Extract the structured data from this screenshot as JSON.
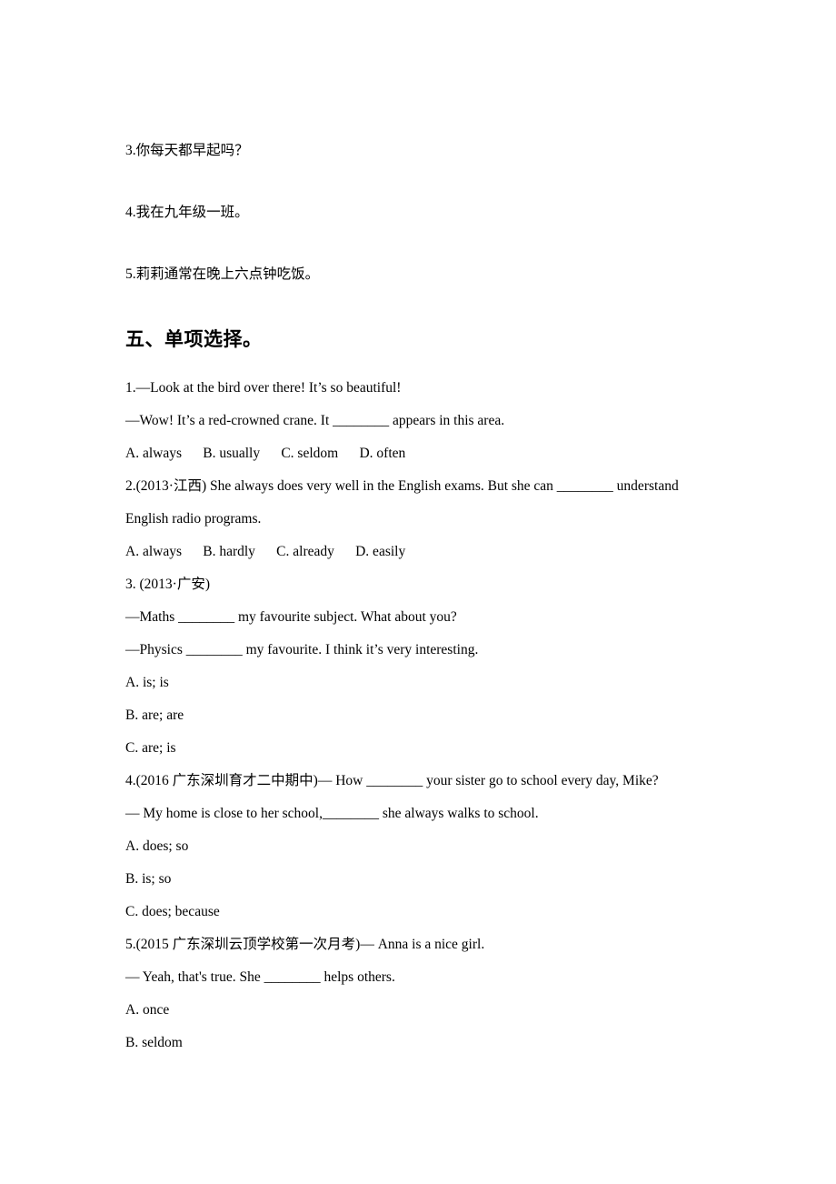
{
  "document": {
    "translation_section": {
      "items": [
        {
          "number": "3.",
          "text": "你每天都早起吗？"
        },
        {
          "number": "4.",
          "text": "我在九年级一班。"
        },
        {
          "number": "5.",
          "text": "莉莉通常在晚上六点钟吃饭。"
        }
      ]
    },
    "choice_section": {
      "heading": "五、单项选择。",
      "questions": [
        {
          "id": "q1",
          "lines": [
            "1.—Look at the bird over there! It’s so beautiful!",
            "—Wow! It’s a red-crowned crane. It ________ appears in this area."
          ],
          "options_layout": "inline",
          "options_inline": "A. always      B. usually      C. seldom      D. often",
          "options": [
            "A. always",
            "B. usually",
            "C. seldom",
            "D. often"
          ]
        },
        {
          "id": "q2",
          "lines": [
            "2.(2013·江西) She always does very well in the English exams. But she can ________ understand",
            "English radio programs."
          ],
          "options_layout": "inline",
          "options_inline": "A. always      B. hardly      C. already      D. easily",
          "options": [
            "A. always",
            "B. hardly",
            "C. already",
            "D. easily"
          ]
        },
        {
          "id": "q3",
          "lines": [
            "3. (2013·广安)",
            "—Maths ________ my favourite subject. What about you?",
            "—Physics ________ my favourite. I think it’s very interesting."
          ],
          "options_layout": "stacked",
          "options": [
            "A. is; is",
            "B. are; are",
            "C. are; is"
          ]
        },
        {
          "id": "q4",
          "lines": [
            "4.(2016 广东深圳育才二中期中)— How ________ your sister go to school every day, Mike?",
            "— My home is close to her school,________ she always walks to school."
          ],
          "options_layout": "stacked",
          "options": [
            "A. does; so",
            "B. is; so",
            "C. does; because"
          ]
        },
        {
          "id": "q5",
          "lines": [
            "5.(2015 广东深圳云顶学校第一次月考)— Anna is a nice girl.",
            "— Yeah, that's true. She ________ helps others."
          ],
          "options_layout": "stacked",
          "options": [
            "A. once",
            "B. seldom"
          ]
        }
      ]
    }
  }
}
